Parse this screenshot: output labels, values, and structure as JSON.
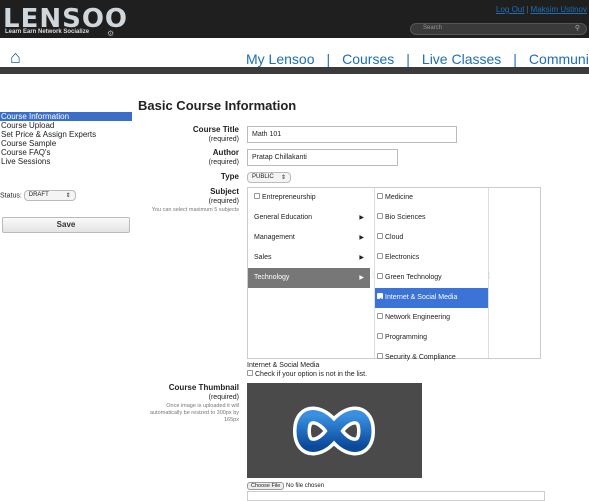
{
  "header": {
    "logo": "LENSOO",
    "tagline": "Learn Earn Network Socialize",
    "logout_label": "Log Out",
    "user_name": "Maksim Ustinov",
    "search_placeholder": "Search"
  },
  "nav": {
    "items": [
      "My Lensoo",
      "Courses",
      "Live Classes",
      "Community"
    ]
  },
  "sidebar": {
    "items": [
      {
        "label": "Course Information",
        "active": true
      },
      {
        "label": "Course Upload",
        "active": false
      },
      {
        "label": "Set Price & Assign Experts",
        "active": false
      },
      {
        "label": "Course Sample",
        "active": false
      },
      {
        "label": "Course FAQ's",
        "active": false
      },
      {
        "label": "Live Sessions",
        "active": false
      }
    ],
    "status_label": "Status:",
    "status_value": "DRAFT",
    "save_label": "Save"
  },
  "form": {
    "title": "Basic Course Information",
    "course_title_label": "Course Title",
    "course_title_value": "Math 101",
    "author_label": "Author",
    "author_value": "Pratap Chillakanti",
    "required": "(required)",
    "type_label": "Type",
    "type_value": "PUBLIC",
    "subject_label": "Subject",
    "subject_hint": "You can select maximum 5 subjects",
    "categories": [
      {
        "label": "Entrepreneurship",
        "checkbox": true,
        "arrow": false,
        "selected": false
      },
      {
        "label": "General Education",
        "checkbox": false,
        "arrow": true,
        "selected": false
      },
      {
        "label": "Management",
        "checkbox": false,
        "arrow": true,
        "selected": false
      },
      {
        "label": "Sales",
        "checkbox": false,
        "arrow": true,
        "selected": false
      },
      {
        "label": "Technology",
        "checkbox": false,
        "arrow": true,
        "selected": true
      }
    ],
    "subjects": [
      {
        "label": "Medicine",
        "checked": false
      },
      {
        "label": "Bio Sciences",
        "checked": false
      },
      {
        "label": "Cloud",
        "checked": false
      },
      {
        "label": "Electronics",
        "checked": false
      },
      {
        "label": "Green Technology",
        "checked": false
      },
      {
        "label": "Internet & Social Media",
        "checked": true
      },
      {
        "label": "Network Engineering",
        "checked": false
      },
      {
        "label": "Programming",
        "checked": false
      },
      {
        "label": "Security & Compliance",
        "checked": false
      }
    ],
    "selected_subjects_text": "Internet & Social Media",
    "not_in_list_label": "Check if your option is not in the list.",
    "thumbnail_label": "Course Thumbnail",
    "thumbnail_hint": "Once image is uploaded it will automatically be resized to 300px by 165px",
    "choose_file_label": "Choose File",
    "no_file_text": "No file chosen",
    "accent_color": "#3b73d6"
  }
}
